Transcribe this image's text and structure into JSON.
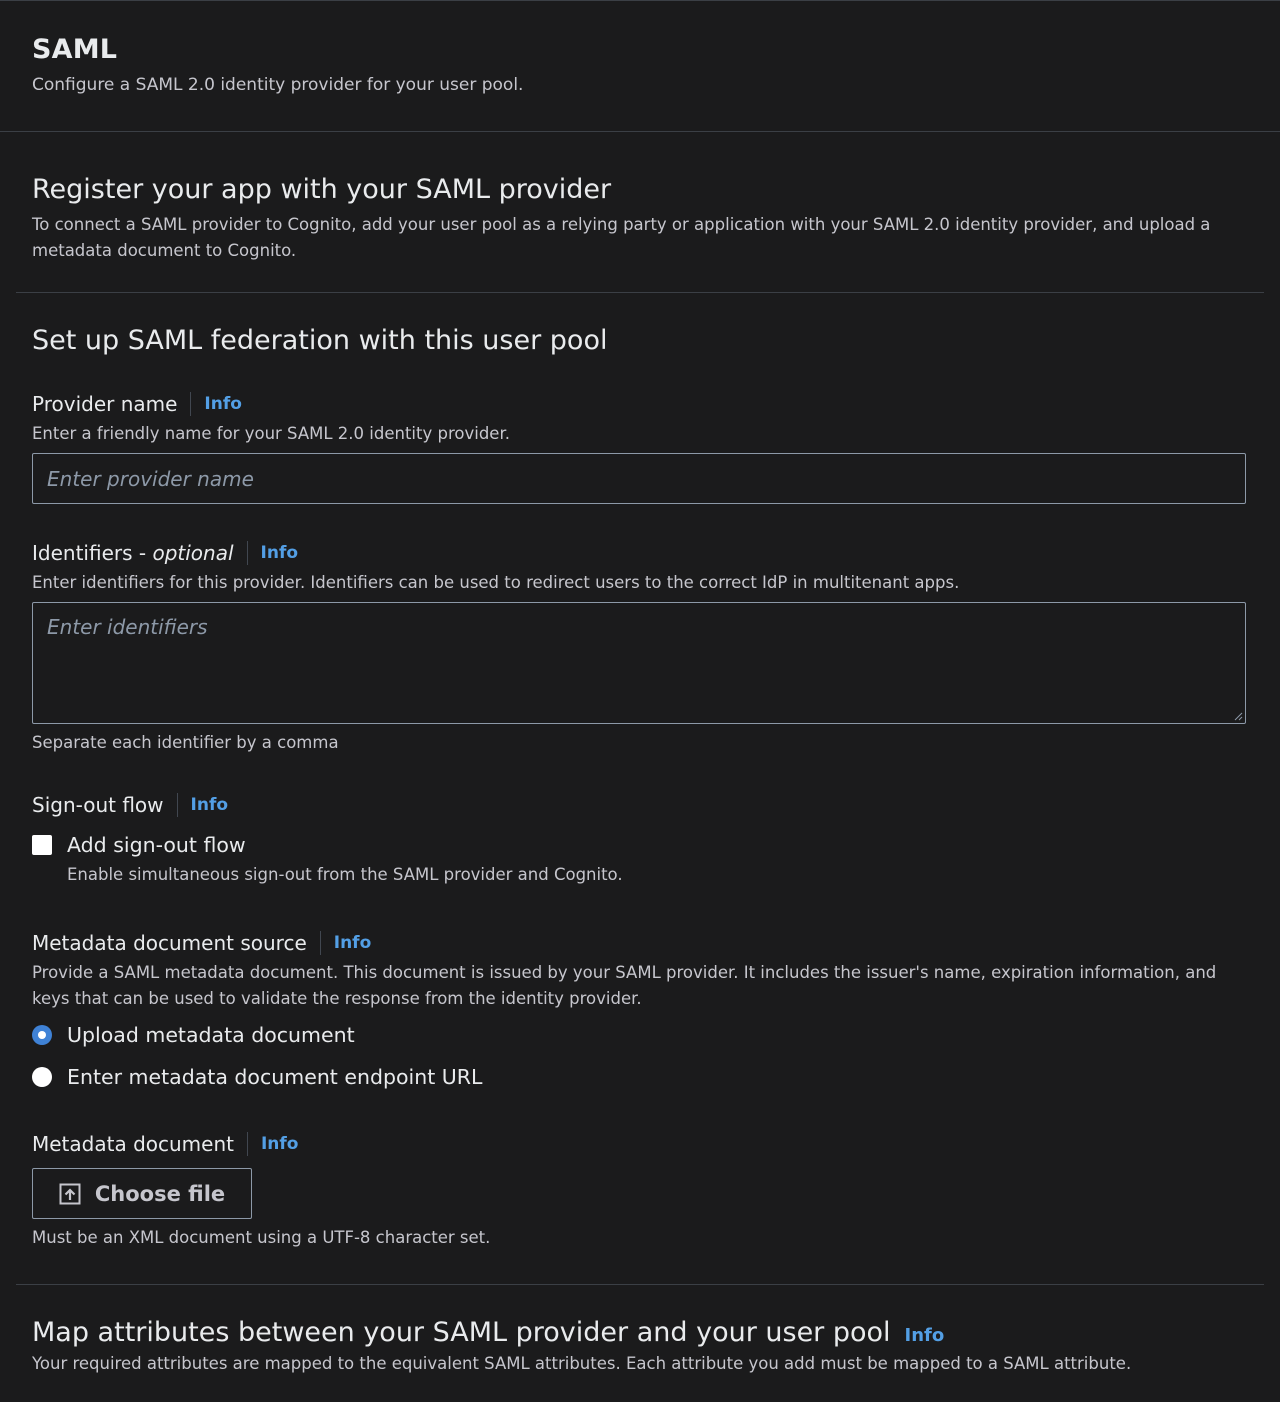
{
  "header": {
    "title": "SAML",
    "description": "Configure a SAML 2.0 identity provider for your user pool."
  },
  "register": {
    "title": "Register your app with your SAML provider",
    "description": "To connect a SAML provider to Cognito, add your user pool as a relying party or application with your SAML 2.0 identity provider, and upload a metadata document to Cognito."
  },
  "setup": {
    "title": "Set up SAML federation with this user pool",
    "info_label": "Info",
    "provider_name": {
      "label": "Provider name",
      "description": "Enter a friendly name for your SAML 2.0 identity provider.",
      "placeholder": "Enter provider name",
      "value": ""
    },
    "identifiers": {
      "label": "Identifiers - ",
      "label_optional": "optional",
      "description": "Enter identifiers for this provider. Identifiers can be used to redirect users to the correct IdP in multitenant apps.",
      "placeholder": "Enter identifiers",
      "constraint": "Separate each identifier by a comma"
    },
    "signout": {
      "label": "Sign-out flow",
      "checkbox_label": "Add sign-out flow",
      "checkbox_description": "Enable simultaneous sign-out from the SAML provider and Cognito.",
      "checked": false
    },
    "metadata_source": {
      "label": "Metadata document source",
      "description": "Provide a SAML metadata document. This document is issued by your SAML provider. It includes the issuer's name, expiration information, and keys that can be used to validate the response from the identity provider.",
      "options": [
        {
          "label": "Upload metadata document",
          "selected": true
        },
        {
          "label": "Enter metadata document endpoint URL",
          "selected": false
        }
      ]
    },
    "metadata_document": {
      "label": "Metadata document",
      "button_label": "Choose file",
      "constraint": "Must be an XML document using a UTF-8 character set."
    }
  },
  "map": {
    "title": "Map attributes between your SAML provider and your user pool",
    "description": "Your required attributes are mapped to the equivalent SAML attributes. Each attribute you add must be mapped to a SAML attribute."
  },
  "colors": {
    "background": "#1b1b1c",
    "link": "#539fe5",
    "radio_selected": "#3f82d6",
    "border": "#8d99a8"
  }
}
